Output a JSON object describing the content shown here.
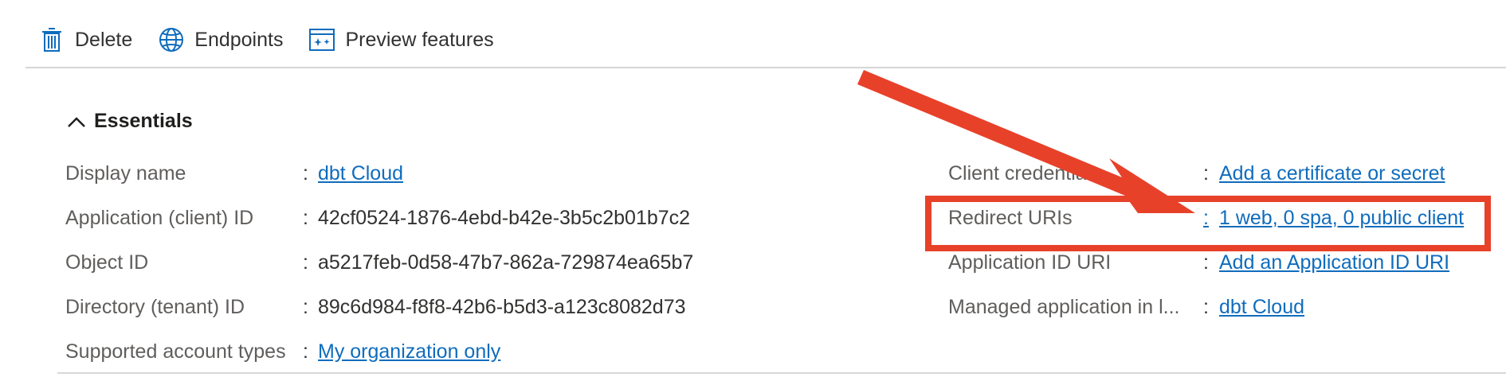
{
  "toolbar": {
    "items": [
      {
        "label": "Delete",
        "icon": "trash-icon"
      },
      {
        "label": "Endpoints",
        "icon": "globe-icon"
      },
      {
        "label": "Preview features",
        "icon": "preview-features-icon"
      }
    ]
  },
  "essentials": {
    "title": "Essentials",
    "separator": ":",
    "left": [
      {
        "key": "Display name",
        "value": "dbt Cloud",
        "link": true
      },
      {
        "key": "Application (client) ID",
        "value": "42cf0524-1876-4ebd-b42e-3b5c2b01b7c2",
        "link": false
      },
      {
        "key": "Object ID",
        "value": "a5217feb-0d58-47b7-862a-729874ea65b7",
        "link": false
      },
      {
        "key": "Directory (tenant) ID",
        "value": "89c6d984-f8f8-42b6-b5d3-a123c8082d73",
        "link": false
      },
      {
        "key": "Supported account types",
        "value": "My organization only",
        "link": true
      }
    ],
    "right": [
      {
        "key": "Client credentials",
        "value": "Add a certificate or secret",
        "link": true
      },
      {
        "key": "Redirect URIs",
        "value": "1 web, 0 spa, 0 public client",
        "link": true
      },
      {
        "key": "Application ID URI",
        "value": "Add an Application ID URI",
        "link": true
      },
      {
        "key": "Managed application in l...",
        "value": "dbt Cloud",
        "link": true
      }
    ]
  },
  "colors": {
    "link": "#0f6cbd",
    "icon": "#0f6cbd",
    "annotation": "#e8412a",
    "divider": "#d6d6d6"
  }
}
